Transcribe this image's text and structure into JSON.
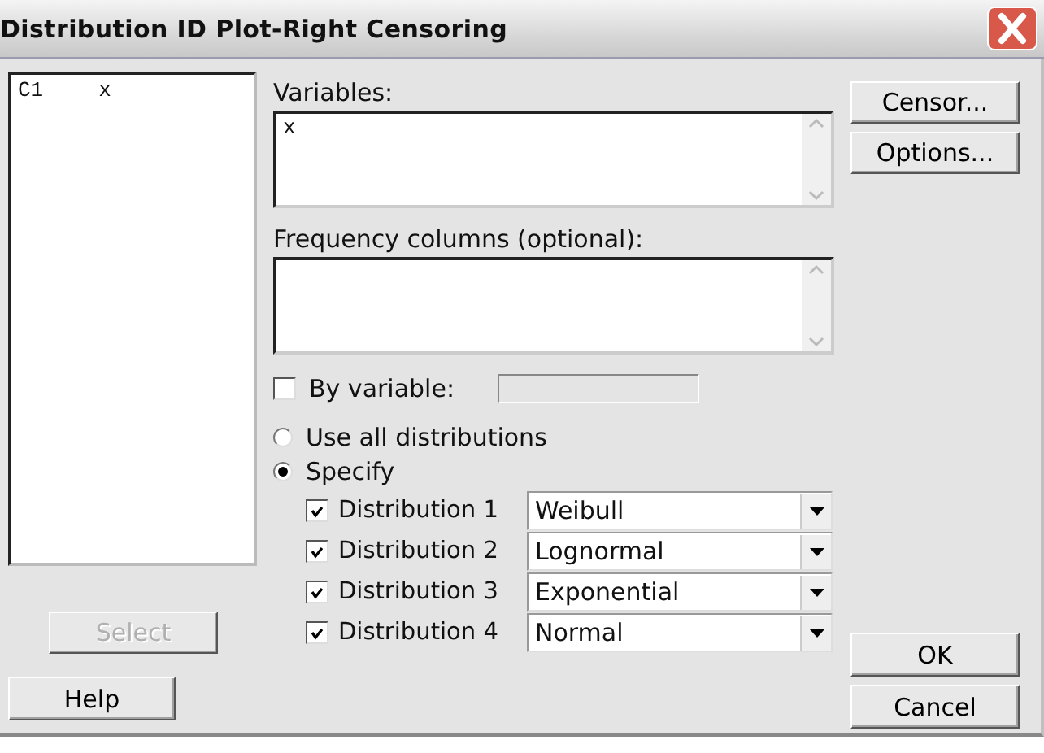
{
  "window": {
    "title": "Distribution ID Plot-Right Censoring"
  },
  "column_list": {
    "items": [
      {
        "column": "C1",
        "name": "x"
      }
    ]
  },
  "variables": {
    "label": "Variables:",
    "value": "x"
  },
  "frequency": {
    "label": "Frequency columns (optional):"
  },
  "by_variable": {
    "label": "By variable:",
    "checked": false
  },
  "distribution_mode": [
    {
      "label": "Use all distributions",
      "selected": false
    },
    {
      "label": "Specify",
      "selected": true
    }
  ],
  "distributions": [
    {
      "label": "Distribution 1",
      "checked": true,
      "value": "Weibull"
    },
    {
      "label": "Distribution 2",
      "checked": true,
      "value": "Lognormal"
    },
    {
      "label": "Distribution 3",
      "checked": true,
      "value": "Exponential"
    },
    {
      "label": "Distribution 4",
      "checked": true,
      "value": "Normal"
    }
  ],
  "left_buttons": [
    {
      "label": "Select",
      "disabled": true
    },
    {
      "label": "Help",
      "disabled": false
    }
  ],
  "right_top_buttons": [
    {
      "label": "Censor..."
    },
    {
      "label": "Options..."
    }
  ],
  "right_bottom_buttons": [
    {
      "label": "OK"
    },
    {
      "label": "Cancel"
    }
  ]
}
